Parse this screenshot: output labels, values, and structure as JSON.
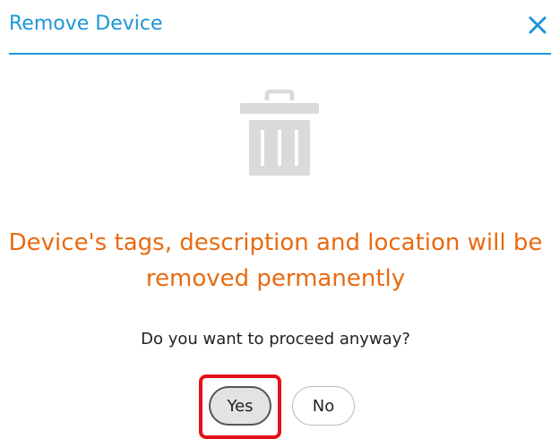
{
  "dialog": {
    "title": "Remove Device",
    "close_icon": "close-icon",
    "image_icon": "trash-icon",
    "warning": "Device's tags, description and location will be removed permanently",
    "question": "Do you want to proceed anyway?",
    "buttons": {
      "yes": "Yes",
      "no": "No"
    }
  },
  "colors": {
    "title": "#1e96d8",
    "divider": "#1e96d8",
    "warning": "#e86a10",
    "icon": "#d8dadc",
    "highlight": "#e5111a"
  }
}
